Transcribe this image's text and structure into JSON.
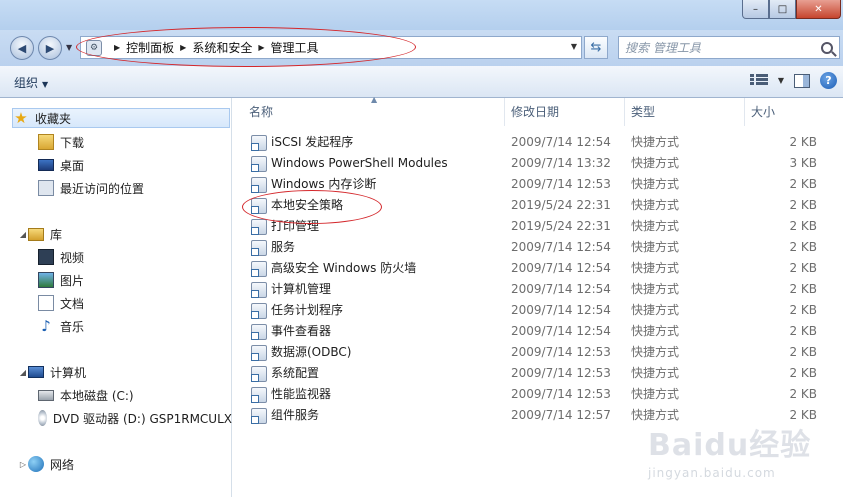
{
  "window": {
    "controls": {
      "minimize": "–",
      "maximize": "□",
      "close": "✕"
    }
  },
  "address": {
    "crumbs": [
      "控制面板",
      "系统和安全",
      "管理工具"
    ],
    "search_placeholder": "搜索 管理工具"
  },
  "toolbar": {
    "organize_label": "组织"
  },
  "sidebar": {
    "favorites": {
      "label": "收藏夹",
      "icon": "star-icon"
    },
    "favorites_items": [
      {
        "label": "下载",
        "icon": "download-folder-icon"
      },
      {
        "label": "桌面",
        "icon": "desktop-icon"
      },
      {
        "label": "最近访问的位置",
        "icon": "recent-places-icon"
      }
    ],
    "libraries": {
      "label": "库",
      "icon": "library-icon"
    },
    "library_items": [
      {
        "label": "视频",
        "icon": "video-icon"
      },
      {
        "label": "图片",
        "icon": "pictures-icon"
      },
      {
        "label": "文档",
        "icon": "documents-icon"
      },
      {
        "label": "音乐",
        "icon": "music-icon"
      }
    ],
    "computer": {
      "label": "计算机",
      "icon": "computer-icon"
    },
    "computer_items": [
      {
        "label": "本地磁盘 (C:)",
        "icon": "local-disk-icon"
      },
      {
        "label": "DVD 驱动器 (D:) GSP1RMCULX",
        "icon": "dvd-drive-icon"
      }
    ],
    "network": {
      "label": "网络",
      "icon": "network-icon"
    }
  },
  "columns": {
    "name": "名称",
    "date": "修改日期",
    "type": "类型",
    "size": "大小"
  },
  "files": [
    {
      "name": "iSCSI 发起程序",
      "date": "2009/7/14 12:54",
      "type": "快捷方式",
      "size": "2 KB"
    },
    {
      "name": "Windows PowerShell Modules",
      "date": "2009/7/14 13:32",
      "type": "快捷方式",
      "size": "3 KB"
    },
    {
      "name": "Windows 内存诊断",
      "date": "2009/7/14 12:53",
      "type": "快捷方式",
      "size": "2 KB"
    },
    {
      "name": "本地安全策略",
      "date": "2019/5/24 22:31",
      "type": "快捷方式",
      "size": "2 KB"
    },
    {
      "name": "打印管理",
      "date": "2019/5/24 22:31",
      "type": "快捷方式",
      "size": "2 KB"
    },
    {
      "name": "服务",
      "date": "2009/7/14 12:54",
      "type": "快捷方式",
      "size": "2 KB"
    },
    {
      "name": "高级安全 Windows 防火墙",
      "date": "2009/7/14 12:54",
      "type": "快捷方式",
      "size": "2 KB"
    },
    {
      "name": "计算机管理",
      "date": "2009/7/14 12:54",
      "type": "快捷方式",
      "size": "2 KB"
    },
    {
      "name": "任务计划程序",
      "date": "2009/7/14 12:54",
      "type": "快捷方式",
      "size": "2 KB"
    },
    {
      "name": "事件查看器",
      "date": "2009/7/14 12:54",
      "type": "快捷方式",
      "size": "2 KB"
    },
    {
      "name": "数据源(ODBC)",
      "date": "2009/7/14 12:53",
      "type": "快捷方式",
      "size": "2 KB"
    },
    {
      "name": "系统配置",
      "date": "2009/7/14 12:53",
      "type": "快捷方式",
      "size": "2 KB"
    },
    {
      "name": "性能监视器",
      "date": "2009/7/14 12:53",
      "type": "快捷方式",
      "size": "2 KB"
    },
    {
      "name": "组件服务",
      "date": "2009/7/14 12:57",
      "type": "快捷方式",
      "size": "2 KB"
    }
  ],
  "watermark": {
    "logo": "Baidu经验",
    "url": "jingyan.baidu.com"
  }
}
